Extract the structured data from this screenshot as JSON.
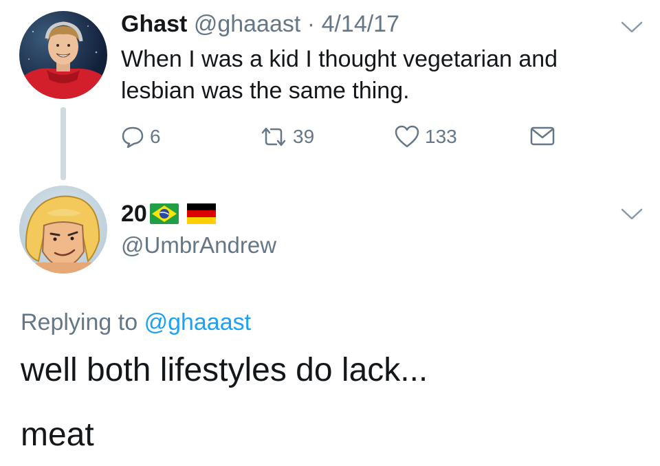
{
  "tweet": {
    "author_name": "Ghast",
    "author_handle": "@ghaaast",
    "separator": "·",
    "date": "4/14/17",
    "text": "When I was a kid I thought vegetarian and lesbian was the same thing.",
    "reply_count": "6",
    "retweet_count": "39",
    "like_count": "133"
  },
  "reply": {
    "author_name": "20",
    "flags": [
      "brazil-flag",
      "germany-flag"
    ],
    "author_handle": "@UmbrAndrew",
    "replying_prefix": "Replying to",
    "replying_to": "@ghaaast",
    "text_lines": [
      "well both lifestyles do lack...",
      "meat"
    ]
  },
  "colors": {
    "text_primary": "#14171a",
    "text_secondary": "#657786",
    "link": "#1da1f2",
    "thread_line": "#cfd9de"
  },
  "icons": [
    "reply-icon",
    "retweet-icon",
    "heart-icon",
    "envelope-icon",
    "chevron-down-icon"
  ]
}
